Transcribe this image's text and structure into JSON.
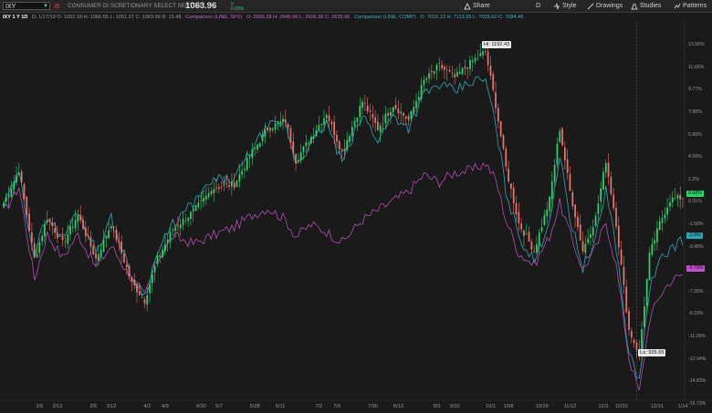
{
  "header": {
    "symbol": "IXY",
    "description": "CONSUMER DI SCRETIONARY SELECT SECTOR",
    "last_price": "1063.96",
    "change_line1": "0",
    "change_line2": "0.00%",
    "share_label": "Share",
    "d_label": "D",
    "style_label": "Style",
    "drawings_label": "Drawings",
    "studies_label": "Studies",
    "patterns_label": "Patterns"
  },
  "infobar": {
    "period": "IXY 1 Y 1D",
    "main_ohlc": "D: 1/17/19  O: 1052.18  H: 1066.55  L: 1051.07  C: 1063.96  R: 15.48",
    "spx_label": "Comparison (LINE, SPX)",
    "spx_ohlc": "O: 2609.28  H: 2645.06  L: 2606.36  C: 2635.96",
    "comp_label": "Comparison (LINE, COMP)",
    "comp_ohlc": "O: 7010.13  H: 7113.95  L: 7003.62  C: 7084.46"
  },
  "colors": {
    "up": "#2ed36b",
    "down": "#f0736c",
    "spx": "#b54cb8",
    "comp": "#2ba6b9",
    "background": "#1a1a1a"
  },
  "callouts": {
    "high": "Hi: 1192.43",
    "low": "Lo: 926.65"
  },
  "price_tags": {
    "main": "0.68%",
    "comp": "-2.9%",
    "spx": "-5.79%"
  },
  "chart_data": {
    "type": "candlestick",
    "title": "CONSUMER DI SCRETIONARY SELECT SECTOR",
    "y_unit": "% change",
    "ylim": [
      -17.5,
      15.5
    ],
    "yticks": [
      "13.56%",
      "11.66%",
      "9.77%",
      "7.88%",
      "5.99%",
      "4.09%",
      "2.2%",
      "0.31%",
      "-1.58%",
      "-3.48%",
      "-5.37%",
      "-7.26%",
      "-9.15%",
      "-11.05%",
      "-12.94%",
      "-14.83%",
      "-16.73%"
    ],
    "ytick_values": [
      13.56,
      11.66,
      9.77,
      7.88,
      5.99,
      4.09,
      2.2,
      0.31,
      -1.58,
      -3.48,
      -5.37,
      -7.26,
      -9.15,
      -11.05,
      -12.94,
      -14.83,
      -16.73
    ],
    "xticks": [
      "2/5",
      "2/12",
      "3/5",
      "3/12",
      "4/2",
      "4/9",
      "4/30",
      "5/7",
      "5/28",
      "6/11",
      "7/2",
      "7/9",
      "7/30",
      "8/13",
      "9/3",
      "9/10",
      "10/1",
      "10/8",
      "10/29",
      "11/12",
      "12/3",
      "12/10",
      "12/31",
      "1/14"
    ],
    "xtick_index": [
      14,
      21,
      35,
      42,
      56,
      63,
      77,
      84,
      98,
      108,
      123,
      130,
      144,
      154,
      169,
      176,
      190,
      197,
      210,
      221,
      234,
      241,
      255,
      265
    ],
    "main_anchors": [
      [
        0,
        0.2
      ],
      [
        6,
        3.0
      ],
      [
        12,
        -4.5
      ],
      [
        17,
        -1.0
      ],
      [
        23,
        -3.2
      ],
      [
        29,
        -0.8
      ],
      [
        36,
        -4.5
      ],
      [
        42,
        -1.5
      ],
      [
        50,
        -6.5
      ],
      [
        55,
        -8.0
      ],
      [
        60,
        -4.5
      ],
      [
        66,
        -2.0
      ],
      [
        74,
        -0.5
      ],
      [
        82,
        1.5
      ],
      [
        90,
        1.8
      ],
      [
        97,
        4.5
      ],
      [
        103,
        6.5
      ],
      [
        110,
        7.2
      ],
      [
        114,
        3.8
      ],
      [
        120,
        5.8
      ],
      [
        126,
        7.8
      ],
      [
        132,
        4.5
      ],
      [
        140,
        8.8
      ],
      [
        146,
        6.5
      ],
      [
        152,
        8.5
      ],
      [
        158,
        7.2
      ],
      [
        164,
        10.5
      ],
      [
        170,
        11.8
      ],
      [
        176,
        10.8
      ],
      [
        183,
        12.2
      ],
      [
        188,
        13.0
      ],
      [
        192,
        8.5
      ],
      [
        196,
        3.2
      ],
      [
        201,
        -1.5
      ],
      [
        207,
        -3.8
      ],
      [
        213,
        0.5
      ],
      [
        217,
        6.5
      ],
      [
        221,
        1.2
      ],
      [
        226,
        -3.8
      ],
      [
        231,
        -1.0
      ],
      [
        235,
        3.8
      ],
      [
        239,
        -1.5
      ],
      [
        244,
        -10.5
      ],
      [
        248,
        -12.5
      ],
      [
        252,
        -4.2
      ],
      [
        256,
        -1.5
      ],
      [
        260,
        0.5
      ],
      [
        265,
        0.68
      ]
    ],
    "comp_anchors": [
      [
        0,
        0.0
      ],
      [
        6,
        2.6
      ],
      [
        12,
        -4.2
      ],
      [
        17,
        -0.8
      ],
      [
        23,
        -2.8
      ],
      [
        29,
        -0.4
      ],
      [
        36,
        -3.8
      ],
      [
        42,
        -1.1
      ],
      [
        50,
        -6.0
      ],
      [
        55,
        -7.6
      ],
      [
        60,
        -4.0
      ],
      [
        66,
        -1.6
      ],
      [
        74,
        0.2
      ],
      [
        82,
        2.1
      ],
      [
        90,
        2.2
      ],
      [
        97,
        4.8
      ],
      [
        103,
        6.6
      ],
      [
        110,
        7.0
      ],
      [
        114,
        3.6
      ],
      [
        120,
        5.2
      ],
      [
        126,
        7.0
      ],
      [
        132,
        3.6
      ],
      [
        140,
        7.6
      ],
      [
        146,
        5.6
      ],
      [
        152,
        7.6
      ],
      [
        158,
        6.6
      ],
      [
        164,
        9.4
      ],
      [
        170,
        10.2
      ],
      [
        176,
        9.6
      ],
      [
        183,
        10.5
      ],
      [
        188,
        10.6
      ],
      [
        192,
        6.8
      ],
      [
        196,
        1.2
      ],
      [
        201,
        -2.5
      ],
      [
        207,
        -4.8
      ],
      [
        213,
        -1.2
      ],
      [
        217,
        4.2
      ],
      [
        221,
        -1.0
      ],
      [
        226,
        -5.2
      ],
      [
        231,
        -3.0
      ],
      [
        235,
        1.5
      ],
      [
        239,
        -3.5
      ],
      [
        244,
        -12.5
      ],
      [
        248,
        -14.8
      ],
      [
        252,
        -7.0
      ],
      [
        256,
        -4.8
      ],
      [
        260,
        -3.6
      ],
      [
        265,
        -2.9
      ]
    ],
    "spx_anchors": [
      [
        0,
        -0.6
      ],
      [
        6,
        1.6
      ],
      [
        12,
        -6.2
      ],
      [
        17,
        -2.4
      ],
      [
        23,
        -4.4
      ],
      [
        29,
        -2.4
      ],
      [
        36,
        -5.2
      ],
      [
        42,
        -3.4
      ],
      [
        50,
        -6.2
      ],
      [
        55,
        -7.6
      ],
      [
        60,
        -4.6
      ],
      [
        66,
        -2.6
      ],
      [
        74,
        -3.2
      ],
      [
        82,
        -2.5
      ],
      [
        90,
        -1.8
      ],
      [
        97,
        -0.8
      ],
      [
        103,
        -0.2
      ],
      [
        110,
        -1.2
      ],
      [
        114,
        -2.6
      ],
      [
        120,
        -1.6
      ],
      [
        126,
        -2.2
      ],
      [
        132,
        -3.1
      ],
      [
        140,
        -1.2
      ],
      [
        146,
        -0.4
      ],
      [
        152,
        0.4
      ],
      [
        158,
        1.2
      ],
      [
        164,
        2.6
      ],
      [
        170,
        2.0
      ],
      [
        176,
        2.8
      ],
      [
        183,
        3.0
      ],
      [
        188,
        3.6
      ],
      [
        192,
        2.2
      ],
      [
        196,
        -1.2
      ],
      [
        201,
        -4.0
      ],
      [
        207,
        -5.0
      ],
      [
        213,
        -2.6
      ],
      [
        217,
        0.2
      ],
      [
        221,
        -2.4
      ],
      [
        226,
        -5.4
      ],
      [
        231,
        -3.6
      ],
      [
        235,
        -1.4
      ],
      [
        239,
        -5.0
      ],
      [
        244,
        -12.8
      ],
      [
        248,
        -15.8
      ],
      [
        252,
        -9.6
      ],
      [
        256,
        -7.6
      ],
      [
        260,
        -6.4
      ],
      [
        265,
        -5.79
      ]
    ]
  }
}
